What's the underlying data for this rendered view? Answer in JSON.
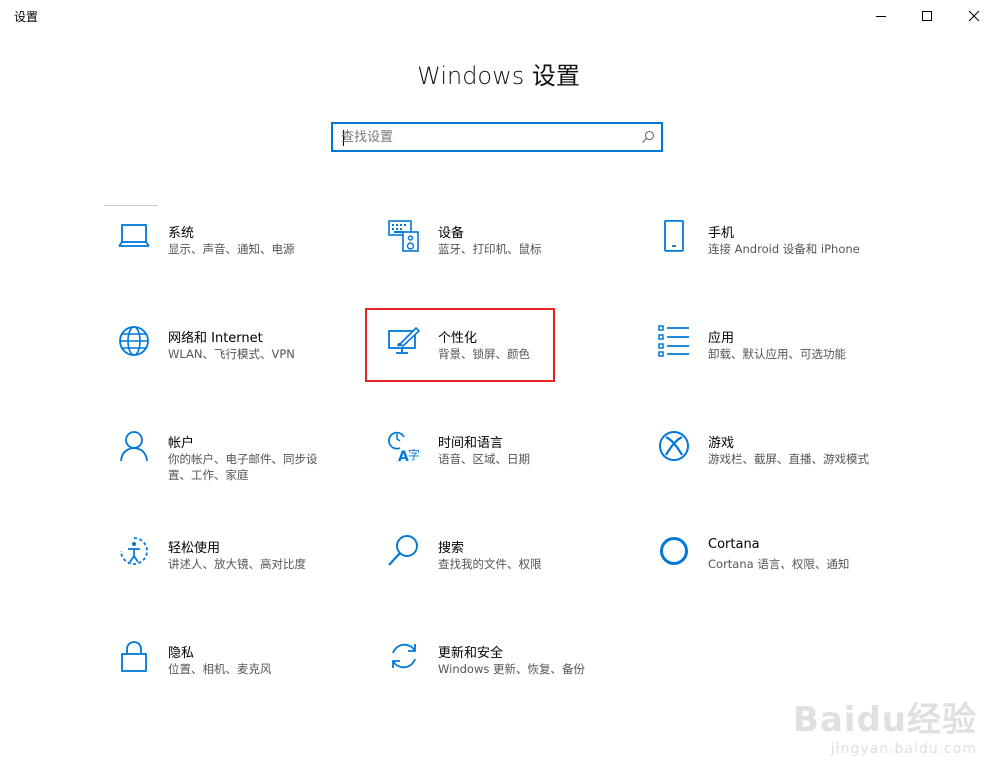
{
  "window": {
    "title": "设置"
  },
  "header": {
    "title": "Windows 设置"
  },
  "search": {
    "placeholder": "查找设置",
    "value": ""
  },
  "accent_color": "#0078d7",
  "highlight_color": "#e52425",
  "tiles": [
    {
      "name": "系统",
      "desc": "显示、声音、通知、电源",
      "icon": "laptop-icon"
    },
    {
      "name": "设备",
      "desc": "蓝牙、打印机、鼠标",
      "icon": "devices-icon"
    },
    {
      "name": "手机",
      "desc": "连接 Android 设备和 iPhone",
      "icon": "phone-icon"
    },
    {
      "name": "网络和 Internet",
      "desc": "WLAN、飞行模式、VPN",
      "icon": "globe-icon"
    },
    {
      "name": "个性化",
      "desc": "背景、锁屏、颜色",
      "icon": "personalization-icon"
    },
    {
      "name": "应用",
      "desc": "卸载、默认应用、可选功能",
      "icon": "apps-list-icon"
    },
    {
      "name": "帐户",
      "desc": "你的帐户、电子邮件、同步设置、工作、家庭",
      "icon": "person-icon"
    },
    {
      "name": "时间和语言",
      "desc": "语音、区域、日期",
      "icon": "time-language-icon"
    },
    {
      "name": "游戏",
      "desc": "游戏栏、截屏、直播、游戏模式",
      "icon": "xbox-icon"
    },
    {
      "name": "轻松使用",
      "desc": "讲述人、放大镜、高对比度",
      "icon": "ease-of-access-icon"
    },
    {
      "name": "搜索",
      "desc": "查找我的文件、权限",
      "icon": "search-icon"
    },
    {
      "name": "Cortana",
      "desc": "Cortana 语言、权限、通知",
      "icon": "cortana-icon"
    },
    {
      "name": "隐私",
      "desc": "位置、相机、麦克风",
      "icon": "lock-icon"
    },
    {
      "name": "更新和安全",
      "desc": "Windows 更新、恢复、备份",
      "icon": "update-icon"
    }
  ],
  "watermark": {
    "main": "Baidu经验",
    "sub": "jingyan.baidu.com"
  }
}
